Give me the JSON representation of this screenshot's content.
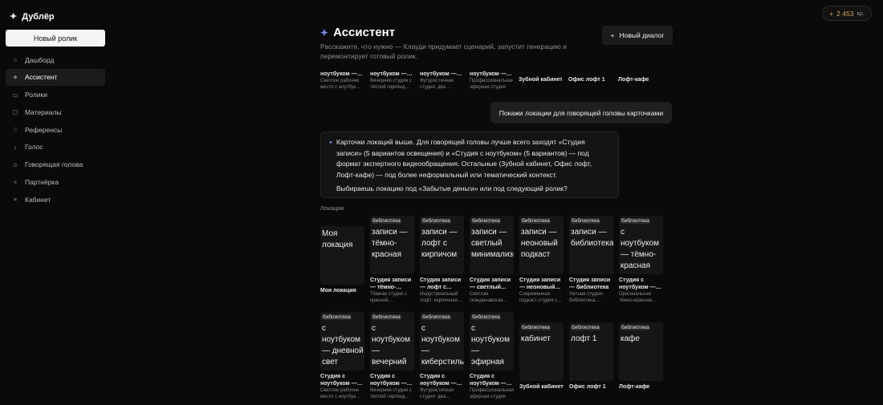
{
  "app": {
    "logo_icon": "✦",
    "name": "Дублёр"
  },
  "sidebar": {
    "new_button": "Новый ролик",
    "items": [
      {
        "icon": "⌂",
        "label": "Дашборд"
      },
      {
        "icon": "✧",
        "label": "Ассистент"
      },
      {
        "icon": "▭",
        "label": "Ролики"
      },
      {
        "icon": "▢",
        "label": "Материалы"
      },
      {
        "icon": "♘",
        "label": "Референсы"
      },
      {
        "icon": "♪",
        "label": "Голос"
      },
      {
        "icon": "☺",
        "label": "Говорящая голова"
      },
      {
        "icon": "✧",
        "label": "Партнёрка"
      },
      {
        "icon": "≡",
        "label": "Кабинет"
      }
    ]
  },
  "credits": {
    "plus": "+",
    "value": "2 453",
    "unit": "кр."
  },
  "header": {
    "icon": "✦",
    "title": "Ассистент",
    "subtitle": "Расскажите, что нужно — Клауди придумает сценарий, запустит генерацию и перемонтирует готовый ролик.",
    "new_dialog_icon": "+",
    "new_dialog": "Новый диалог"
  },
  "top_row": [
    {
      "title": "ноутбуком —…",
      "desc": "Светлое рабочее место с ноутбук…"
    },
    {
      "title": "ноутбуком —…",
      "desc": "Вечерняя студия с тёплой гирлянд…"
    },
    {
      "title": "ноутбуком —…",
      "desc": "Футуристичная студия: два…"
    },
    {
      "title": "ноутбуком —…",
      "desc": "Профессиональная эфирная студия с…"
    },
    {
      "title": "Зубной кабинет",
      "desc": ""
    },
    {
      "title": "Офис лофт 1",
      "desc": ""
    },
    {
      "title": "Лофт-кафе",
      "desc": ""
    }
  ],
  "chat": {
    "user_message": "Покажи локации для говорящей головы карточками",
    "assistant_icon": "✦",
    "assistant_text": "Карточки локаций выше. Для говорящей головы лучше всего заходят «Студия записи» (5 вариантов освещения) и «Студия с ноутбуком» (5 вариантов) — под формат экспертного видеообращения. Остальные (Зубной кабинет, Офис лофт, Лофт-кафе) — под более неформальный или тематический контекст.",
    "assistant_question": "Выбираешь локацию под «Забытые деньги» или под следующий ролик?"
  },
  "locations": {
    "label": "Локации",
    "badge": "библиотека",
    "row1": [
      {
        "thumb": "Моя локация",
        "name": "Моя локация",
        "desc": "",
        "badge": ""
      },
      {
        "thumb": "записи — тёмно-красная",
        "name": "Студия записи — тёмно-…",
        "desc": "Тёмная студия с красной…",
        "badge": "библиотека"
      },
      {
        "thumb": "записи — лофт с кирпичом",
        "name": "Студия записи — лофт с…",
        "desc": "Индустриальный лофт: кирпичная…",
        "badge": "библиотека"
      },
      {
        "thumb": "записи — светлый минимализм",
        "name": "Студия записи — светлый…",
        "desc": "Светлая скандинавская…",
        "badge": "библиотека"
      },
      {
        "thumb": "записи — неоновый подкаст",
        "name": "Студия записи — неоновый…",
        "desc": "Современная подкаст-студия с…",
        "badge": "библиотека"
      },
      {
        "thumb": "записи — библиотека",
        "name": "Студия записи — библиотека",
        "desc": "Уютная студия-библиотека:…",
        "badge": "библиотека"
      },
      {
        "thumb": "с ноутбуком — тёмно-красная",
        "name": "Студия с ноутбуком —…",
        "desc": "Оригинальная тёмно-красная…",
        "badge": "библиотека"
      }
    ],
    "row2": [
      {
        "thumb": "с ноутбуком — дневной свет",
        "name": "Студия с ноутбуком —…",
        "desc": "Светлое рабочее место с ноутбук…",
        "badge": "библиотека"
      },
      {
        "thumb": "с ноутбуком — вечерний уют",
        "name": "Студия с ноутбуком —…",
        "desc": "Вечерняя студия с тёплой гирлянд…",
        "badge": "библиотека"
      },
      {
        "thumb": "с ноутбуком — киберстиль",
        "name": "Студия с ноутбуком —…",
        "desc": "Футуристичная студия: два…",
        "badge": "библиотека"
      },
      {
        "thumb": "с ноутбуком — эфирная студия",
        "name": "Студия с ноутбуком —…",
        "desc": "Профессиональная эфирная студия с…",
        "badge": "библиотека"
      },
      {
        "thumb": "кабинет",
        "name": "Зубной кабинет",
        "desc": "",
        "badge": "библиотека"
      },
      {
        "thumb": "лофт 1",
        "name": "Офис лофт 1",
        "desc": "",
        "badge": "библиотека"
      },
      {
        "thumb": "кафе",
        "name": "Лофт-кафе",
        "desc": "",
        "badge": "библиотека"
      }
    ]
  }
}
